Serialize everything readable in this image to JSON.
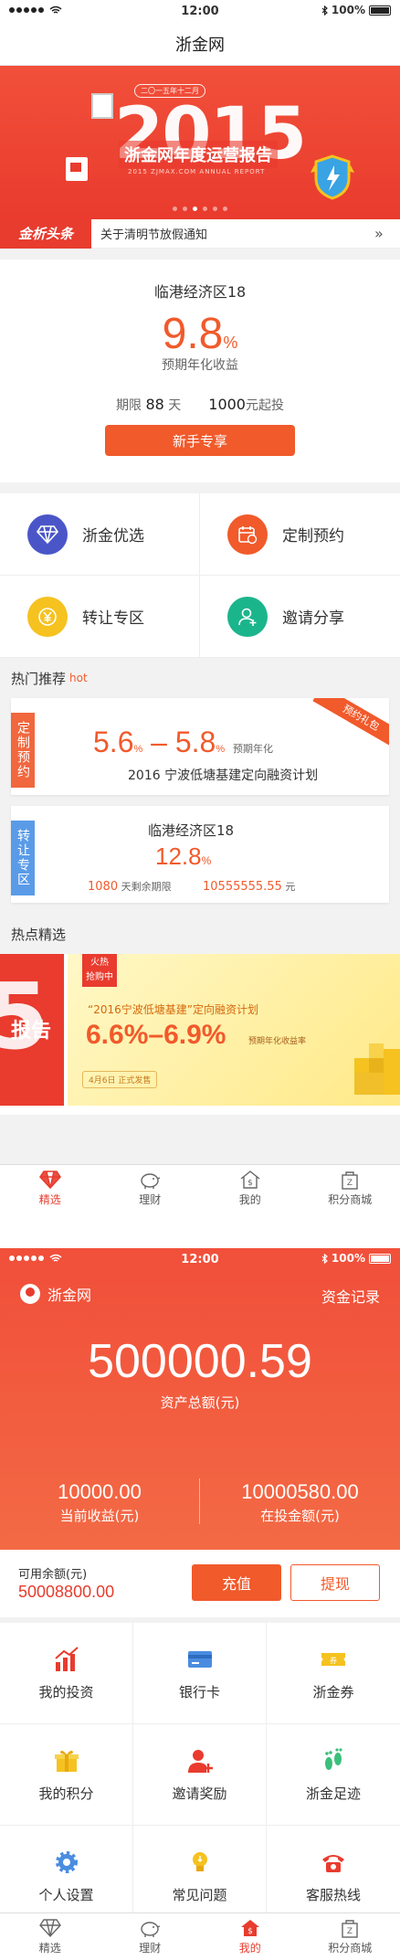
{
  "status": {
    "time": "12:00",
    "battery": "100%"
  },
  "screen1": {
    "nav_title": "浙金网",
    "banner": {
      "year": "2015",
      "subtitle": "二〇一五年十二月",
      "title": "浙金网年度运营报告",
      "en": "2015 ZJMAX.COM ANNUAL REPORT",
      "dots": 6,
      "active_dot": 2
    },
    "news": {
      "tag": "金析头条",
      "text": "关于清明节放假通知",
      "more": "»"
    },
    "product": {
      "name": "临港经济区18",
      "rate": "9.8",
      "rate_unit": "%",
      "rate_label": "预期年化收益",
      "term_label": "期限",
      "term_value": "88",
      "term_unit": "天",
      "min_value": "1000",
      "min_unit": "元起投",
      "button": "新手专享"
    },
    "shortcuts": [
      {
        "label": "浙金优选",
        "icon": "diamond-icon",
        "color": "#4a56c8"
      },
      {
        "label": "定制预约",
        "icon": "calendar-icon",
        "color": "#f15a2b"
      },
      {
        "label": "转让专区",
        "icon": "yen-coin-icon",
        "color": "#f5c220"
      },
      {
        "label": "邀请分享",
        "icon": "user-add-icon",
        "color": "#1bb58c"
      }
    ],
    "hot_title": "热门推荐",
    "hot_tag": "hot",
    "rec1": {
      "side": "定制预约",
      "ribbon": "预约礼包",
      "rate_low": "5.6",
      "rate_high": "5.8",
      "unit": "%",
      "dash": "–",
      "rate_label": "预期年化",
      "name": "2016 宁波低塘基建定向融资计划"
    },
    "rec2": {
      "side": "转让专区",
      "title": "临港经济区18",
      "rate": "12.8",
      "unit": "%",
      "remain_value": "1080",
      "remain_label": "天剩余期限",
      "amount_value": "10555555.55",
      "amount_unit": "元"
    },
    "featured_title": "热点精选",
    "featured": {
      "left_text": "报告",
      "left_year": "5",
      "tag_line1": "火热",
      "tag_line2": "抢购中",
      "desc": "“2016宁波低塘基建”定向融资计划",
      "rate": "6.6%–6.9%",
      "rate_label": "预期年化收益率",
      "date": "4月6日 正式发售"
    },
    "tabs": [
      {
        "label": "精选",
        "icon": "diamond-icon",
        "active": true
      },
      {
        "label": "理财",
        "icon": "piggy-bank-icon",
        "active": false
      },
      {
        "label": "我的",
        "icon": "house-dollar-icon",
        "active": false
      },
      {
        "label": "积分商城",
        "icon": "shopping-bag-icon",
        "active": false
      }
    ]
  },
  "screen2": {
    "user": "浙金网",
    "records": "资金记录",
    "total": "500000.59",
    "total_label": "资产总额(元)",
    "income_value": "10000.00",
    "income_label": "当前收益(元)",
    "invest_value": "10000580.00",
    "invest_label": "在投金额(元)",
    "balance_label": "可用余额(元)",
    "balance_value": "50008800.00",
    "recharge": "充值",
    "withdraw": "提现",
    "menu": [
      {
        "label": "我的投资",
        "icon": "bar-chart-icon"
      },
      {
        "label": "银行卡",
        "icon": "bank-card-icon"
      },
      {
        "label": "浙金券",
        "icon": "coupon-icon"
      },
      {
        "label": "我的积分",
        "icon": "gift-icon"
      },
      {
        "label": "邀请奖励",
        "icon": "invite-icon"
      },
      {
        "label": "浙金足迹",
        "icon": "footprint-icon"
      },
      {
        "label": "个人设置",
        "icon": "settings-icon"
      },
      {
        "label": "常见问题",
        "icon": "lightbulb-icon"
      },
      {
        "label": "客服热线",
        "icon": "phone-icon"
      }
    ],
    "tabs": [
      {
        "label": "精选",
        "icon": "diamond-icon",
        "active": false
      },
      {
        "label": "理财",
        "icon": "piggy-bank-icon",
        "active": false
      },
      {
        "label": "我的",
        "icon": "house-dollar-icon",
        "active": true
      },
      {
        "label": "积分商城",
        "icon": "shopping-bag-icon",
        "active": false
      }
    ]
  }
}
